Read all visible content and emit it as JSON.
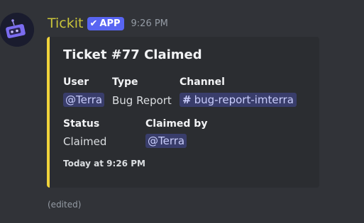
{
  "message": {
    "author": "Tickit",
    "badge": "APP",
    "timestamp": "9:26 PM",
    "edited_label": "(edited)",
    "avatar_icon": "robot-ticket-icon"
  },
  "embed": {
    "accent_color": "#f0d33b",
    "title": "Ticket #77 Claimed",
    "fields": {
      "user": {
        "name": "User",
        "value": "@Terra"
      },
      "type": {
        "name": "Type",
        "value": "Bug Report"
      },
      "channel": {
        "name": "Channel",
        "value": "bug-report-imterra",
        "prefix": "#"
      },
      "status": {
        "name": "Status",
        "value": "Claimed"
      },
      "claimed_by": {
        "name": "Claimed by",
        "value": "@Terra"
      }
    },
    "footer": "Today at 9:26 PM"
  }
}
